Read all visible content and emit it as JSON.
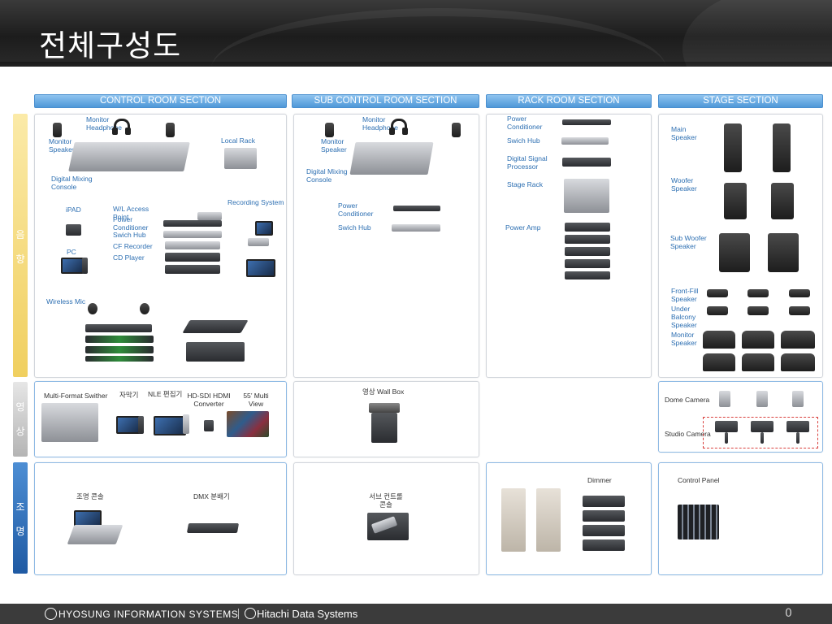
{
  "title": "전체구성도",
  "sections": {
    "control": "CONTROL ROOM SECTION",
    "subcontrol": "SUB CONTROL ROOM SECTION",
    "rack": "RACK ROOM SECTION",
    "stage": "STAGE SECTION"
  },
  "rows": {
    "audio": [
      "음",
      "향"
    ],
    "video": [
      "영",
      "상"
    ],
    "lighting": [
      "조",
      "명"
    ]
  },
  "colors": {
    "audio_tab": "#f3d97a",
    "video_tab": "#c7c7c7",
    "lighting_tab": "#2f6fb7",
    "header": "#5aa3e0"
  },
  "control_audio": {
    "monitor_speaker": "Monitor Speaker",
    "monitor_headphone": "Monitor Headphone",
    "local_rack": "Local Rack",
    "digital_mixing_console": "Digital Mixing Console",
    "ipad": "iPAD",
    "wl_access_point": "W/L Access Point",
    "power_conditioner": "Power Conditioner",
    "swich_hub": "Swich Hub",
    "cf_recorder": "CF Recorder",
    "cd_player": "CD Player",
    "recording_system": "Recording System",
    "pc": "PC",
    "wireless_mic": "Wireless Mic"
  },
  "sub_audio": {
    "monitor_speaker": "Monitor Speaker",
    "monitor_headphone": "Monitor Headphone",
    "digital_mixing_console": "Digital Mixing Console",
    "power_conditioner": "Power Conditioner",
    "swich_hub": "Swich Hub"
  },
  "rack_audio": {
    "power_conditioner": "Power Conditioner",
    "swich_hub": "Swich Hub",
    "digital_signal_processor": "Digital Signal Processor",
    "stage_rack": "Stage Rack",
    "power_amp": "Power Amp"
  },
  "stage_audio": {
    "main_speaker": "Main Speaker",
    "woofer_speaker": "Woofer Speaker",
    "sub_woofer_speaker": "Sub Woofer Speaker",
    "front_fill_speaker": "Front-Fill Speaker",
    "under_balcony_speaker": "Under Balcony Speaker",
    "monitor_speaker": "Monitor Speaker"
  },
  "control_video": {
    "multi_format_switcher": "Multi-Format Swither",
    "caption": "자막기",
    "nle": "NLE 편집기",
    "hdmi_converter": "HD-SDI HDMI Converter",
    "multiview": "55’ Multi View"
  },
  "sub_video": {
    "wall_box": "영상 Wall Box"
  },
  "stage_video": {
    "dome_camera": "Dome Camera",
    "studio_camera": "Studio Camera"
  },
  "control_light": {
    "console": "조명 콘솔",
    "dmx": "DMX 분배기"
  },
  "sub_light": {
    "console": "서브 컨트롤 콘솔"
  },
  "rack_light": {
    "dimmer": "Dimmer"
  },
  "stage_light": {
    "control_panel": "Control Panel"
  },
  "footer": {
    "brand1": "HYOSUNG INFORMATION SYSTEMS",
    "brand2": "Hitachi Data Systems",
    "page_number": "0"
  }
}
